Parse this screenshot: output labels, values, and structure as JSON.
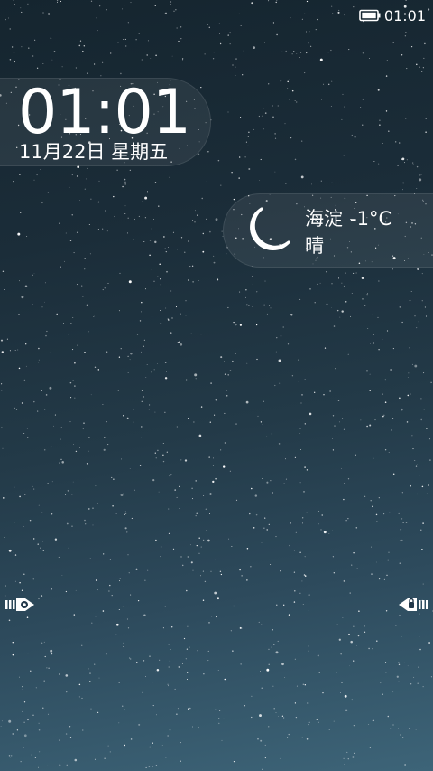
{
  "status_bar": {
    "battery_icon": "battery-icon",
    "time": "01:01"
  },
  "clock": {
    "time": "01:01",
    "date": "11月22日 星期五"
  },
  "weather": {
    "icon": "moon-icon",
    "location": "海淀",
    "temperature": "-1°C",
    "condition": "晴"
  },
  "handles": {
    "left_icon": "camera-arrow-icon",
    "right_icon": "unlock-arrow-icon"
  },
  "colors": {
    "text": "#ffffff",
    "background_top": "#15252f",
    "background_bottom": "#3d6478"
  }
}
